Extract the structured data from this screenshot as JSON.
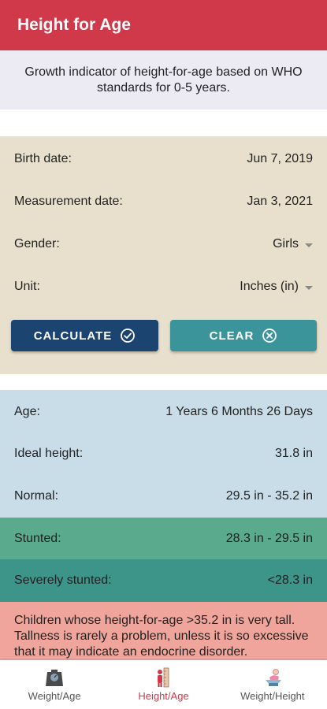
{
  "header": {
    "title": "Height for Age"
  },
  "description": "Growth indicator of height-for-age based on WHO standards for 0-5 years.",
  "inputs": {
    "birth_date": {
      "label": "Birth date:",
      "value": "Jun 7, 2019"
    },
    "measurement_date": {
      "label": "Measurement date:",
      "value": "Jan 3, 2021"
    },
    "gender": {
      "label": "Gender:",
      "value": "Girls"
    },
    "unit": {
      "label": "Unit:",
      "value": "Inches (in)"
    }
  },
  "buttons": {
    "calculate": "CALCULATE",
    "clear": "CLEAR"
  },
  "results": {
    "age": {
      "label": "Age:",
      "value": "1 Years 6 Months 26 Days"
    },
    "ideal": {
      "label": "Ideal height:",
      "value": "31.8 in"
    },
    "normal": {
      "label": "Normal:",
      "value": "29.5 in - 35.2 in"
    },
    "stunted": {
      "label": "Stunted:",
      "value": "28.3 in - 29.5 in"
    },
    "severe": {
      "label": "Severely stunted:",
      "value": "<28.3 in"
    }
  },
  "note": "Children whose height-for-age >35.2 in is very tall. Tallness is rarely a problem, unless it is so excessive that it may indicate an endocrine disorder.",
  "nav": [
    {
      "label": "Weight/Age",
      "icon": "scale-icon"
    },
    {
      "label": "Height/Age",
      "icon": "height-measure-icon"
    },
    {
      "label": "Weight/Height",
      "icon": "baby-scale-icon"
    }
  ],
  "colors": {
    "header": "#d0394a",
    "subtitle_bg": "#eceaf2",
    "input_bg": "#e8e0cd",
    "calculate_btn": "#1c4470",
    "clear_btn": "#3b9499",
    "result_bg": "#c8dde8",
    "stunted_bg": "#5aaa8d",
    "severe_bg": "#3d9488",
    "note_bg": "#f0a59c"
  }
}
